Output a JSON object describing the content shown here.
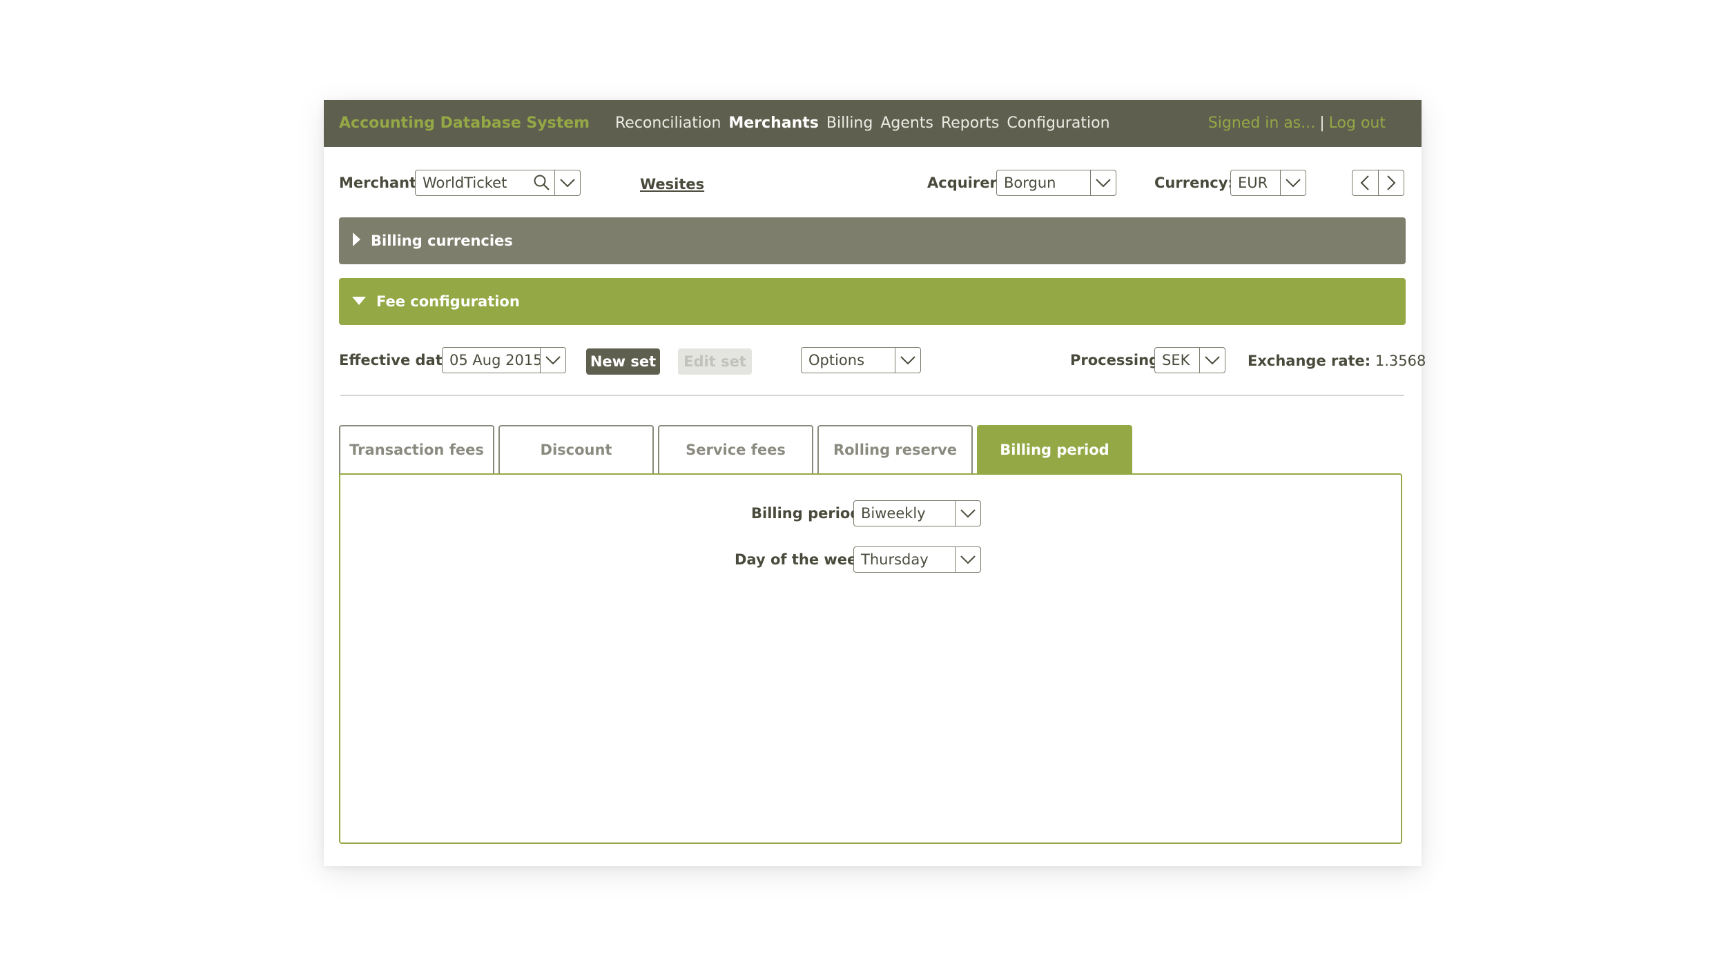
{
  "app": {
    "brand": "Accounting Database System",
    "nav": [
      "Reconciliation",
      "Merchants",
      "Billing",
      "Agents",
      "Reports",
      "Configuration"
    ],
    "nav_active": "Merchants",
    "signed_in": "Signed in as...",
    "separator": "|",
    "logout": "Log out"
  },
  "filters": {
    "merchant_label": "Merchant:",
    "merchant_value": "WorldTicket",
    "websites_link": "Wesites",
    "acquirer_label": "Acquirer:",
    "acquirer_value": "Borgun",
    "currency_label": "Currency:",
    "currency_value": "EUR"
  },
  "panels": {
    "billing_currencies": "Billing currencies",
    "fee_configuration": "Fee configuration"
  },
  "fee_config": {
    "effective_date_label": "Effective date:",
    "effective_date_value": "05 Aug 2015",
    "new_set": "New set",
    "edit_set": "Edit set",
    "options": "Options",
    "processing_label": "Processing:",
    "processing_value": "SEK",
    "exchange_rate_label": "Exchange rate:",
    "exchange_rate_value": "1.3568"
  },
  "tabs": [
    "Transaction fees",
    "Discount",
    "Service fees",
    "Rolling reserve",
    "Billing period"
  ],
  "active_tab": "Billing period",
  "billing_period": {
    "period_label": "Billing period:",
    "period_value": "Biweekly",
    "day_label": "Day of the week:",
    "day_value": "Thursday"
  },
  "colors": {
    "topbar": "#5f5f4f",
    "accent_green": "#94a845",
    "panel_gray": "#7e7e6c"
  }
}
